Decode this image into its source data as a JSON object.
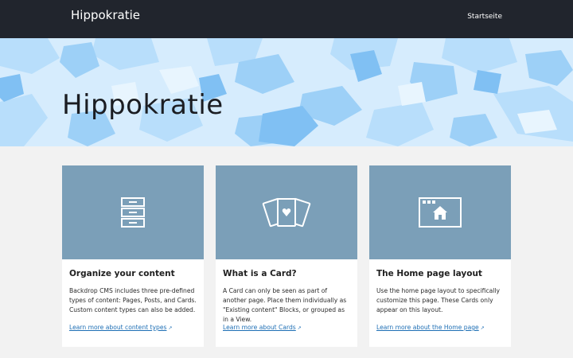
{
  "header": {
    "site_name": "Hippokratie",
    "nav_items": [
      {
        "label": "Startseite"
      }
    ],
    "background": "#21252d"
  },
  "hero": {
    "title": "Hippokratie",
    "pattern_colors": [
      "#bfe2fc",
      "#9fd0f8",
      "#7fbff4",
      "#e6f4fe"
    ]
  },
  "cards": [
    {
      "icon": "file-cabinet-icon",
      "title": "Organize your content",
      "text": "Backdrop CMS includes three pre-defined types of content: Pages, Posts, and Cards. Custom content types can also be added.",
      "link": "Learn more about content types"
    },
    {
      "icon": "playing-cards-icon",
      "title": "What is a Card?",
      "text": "A Card can only be seen as part of another page. Place them individually as \"Existing content\" Blocks, or grouped as in a View.",
      "link": "Learn more about Cards"
    },
    {
      "icon": "browser-home-icon",
      "title": "The Home page layout",
      "text": "Use the home page layout to specifically customize this page. These Cards only appear on this layout.",
      "link": "Learn more about the Home page"
    }
  ],
  "colors": {
    "card_media": "#7b9fb8",
    "link": "#1e6fb5",
    "page_bg": "#f2f2f2"
  }
}
